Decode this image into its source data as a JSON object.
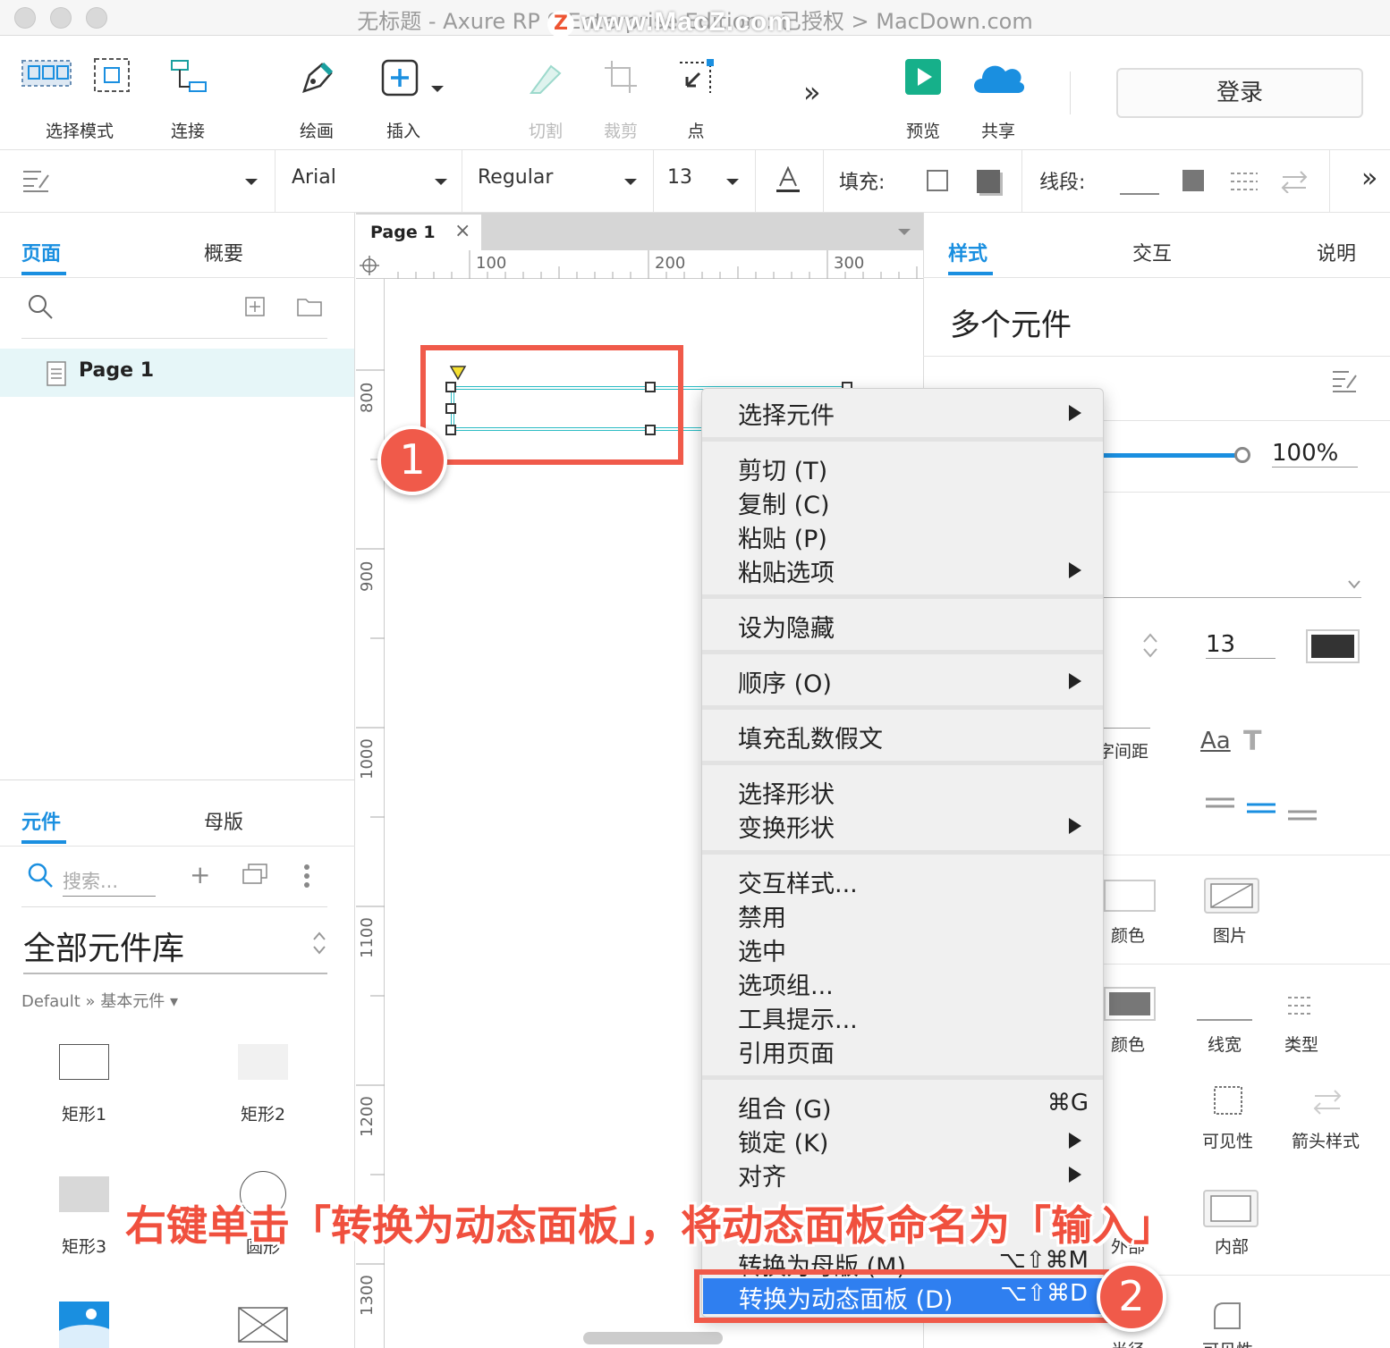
{
  "window": {
    "title": "无标题 - Axure RP 9 Enterprise Edition : 已授权 > MacDown.com",
    "watermark": "www.MacZ.com"
  },
  "toolbar": {
    "select_mode": "选择模式",
    "connect": "连接",
    "draw": "绘画",
    "insert": "插入",
    "cut": "切割",
    "crop": "裁剪",
    "point": "点",
    "preview": "预览",
    "share": "共享",
    "login": "登录"
  },
  "format": {
    "font": "Arial",
    "weight": "Regular",
    "size": "13",
    "fill_label": "填充:",
    "line_label": "线段:"
  },
  "left": {
    "tab_pages": "页面",
    "tab_outline": "概要",
    "page_item": "Page 1",
    "tab_widgets": "元件",
    "tab_masters": "母版",
    "search_placeholder": "搜索...",
    "library": "全部元件库",
    "breadcrumb": "Default » 基本元件 ▾",
    "widgets": [
      "矩形1",
      "矩形2",
      "矩形3",
      "圆形"
    ]
  },
  "canvas": {
    "tab": "Page 1",
    "ruler_h": [
      "100",
      "200",
      "300"
    ],
    "ruler_v": [
      "800",
      "900",
      "1000",
      "1100",
      "1200",
      "1300"
    ]
  },
  "right": {
    "tab_style": "样式",
    "tab_interact": "交互",
    "tab_notes": "说明",
    "heading": "多个元件",
    "opacity": "100%",
    "font_size": "13",
    "spacing": "字间距",
    "fill_color": "颜色",
    "fill_image": "图片",
    "line_color": "颜色",
    "line_width": "线宽",
    "line_type": "类型",
    "visibility": "可见性",
    "arrow_style": "箭头样式",
    "outer": "外部",
    "inner": "内部",
    "radius": "半径",
    "visibility2": "可见性"
  },
  "menu": {
    "select_widget": "选择元件",
    "cut": "剪切 (T)",
    "copy": "复制 (C)",
    "paste": "粘贴 (P)",
    "paste_options": "粘贴选项",
    "hide": "设为隐藏",
    "order": "顺序 (O)",
    "lorem": "填充乱数假文",
    "select_shape": "选择形状",
    "transform_shape": "变换形状",
    "interaction_style": "交互样式...",
    "disable": "禁用",
    "selected": "选中",
    "option_group": "选项组...",
    "tooltip": "工具提示...",
    "ref_page": "引用页面",
    "group": "组合 (G)",
    "group_sc": "⌘G",
    "lock": "锁定 (K)",
    "align": "对齐",
    "to_master": "转换为母版 (M)",
    "to_master_sc": "⌥⇧⌘M",
    "to_dynamic": "转换为动态面板 (D)",
    "to_dynamic_sc": "⌥⇧⌘D"
  },
  "annotation": {
    "badge1": "1",
    "badge2": "2",
    "caption": "右键单击「转换为动态面板」，将动态面板命名为「输入」"
  },
  "colors": {
    "accent": "#1a8fe0",
    "highlight": "#2f7ff0",
    "annotation": "#f05a4a"
  }
}
